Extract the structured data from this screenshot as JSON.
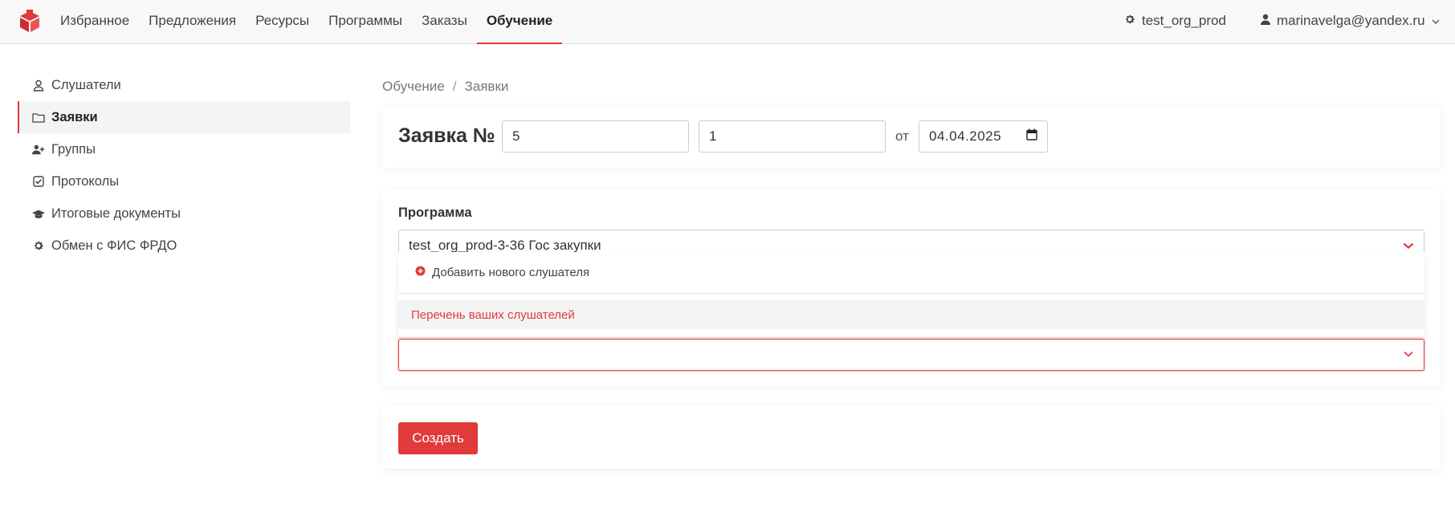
{
  "nav": {
    "items": [
      {
        "label": "Избранное"
      },
      {
        "label": "Предложения"
      },
      {
        "label": "Ресурсы"
      },
      {
        "label": "Программы"
      },
      {
        "label": "Заказы"
      },
      {
        "label": "Обучение",
        "active": true
      }
    ],
    "org": "test_org_prod",
    "user": "marinavelga@yandex.ru"
  },
  "sidebar": {
    "items": [
      {
        "label": "Слушатели",
        "icon": "user-outline-icon"
      },
      {
        "label": "Заявки",
        "icon": "folder-icon",
        "active": true
      },
      {
        "label": "Группы",
        "icon": "user-plus-icon"
      },
      {
        "label": "Протоколы",
        "icon": "check-square-icon"
      },
      {
        "label": "Итоговые документы",
        "icon": "graduation-cap-icon"
      },
      {
        "label": "Обмен с ФИС ФРДО",
        "icon": "gear-icon"
      }
    ]
  },
  "breadcrumb": {
    "first": "Обучение",
    "separator": "/",
    "second": "Заявки"
  },
  "form": {
    "title": "Заявка №",
    "number_value": "5",
    "suffix_value": "1",
    "date_prefix": "от",
    "date_value": "04.04.2025",
    "program_label": "Программа",
    "program_value": "test_org_prod-3-36 Гос закупки",
    "dropdown": {
      "add_label": "Добавить нового слушателя",
      "list_label": "Перечень ваших слушателей"
    },
    "create_button": "Создать"
  },
  "colors": {
    "accent": "#e03a3a",
    "nav_bg": "#f8f8f8"
  }
}
